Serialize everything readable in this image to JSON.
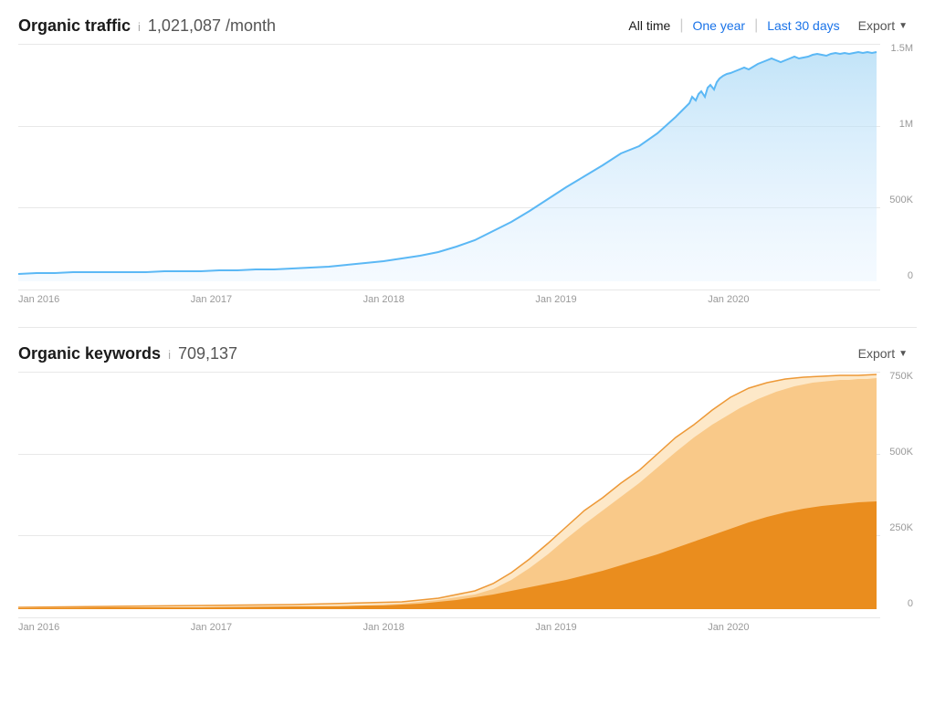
{
  "page": {
    "background": "#ffffff"
  },
  "traffic_chart": {
    "title": "Organic traffic",
    "info_icon": "i",
    "metric": "1,021,087",
    "metric_suffix": "/month",
    "time_filters": [
      {
        "label": "All time",
        "active": true,
        "color": "default"
      },
      {
        "label": "One year",
        "active": false,
        "color": "blue"
      },
      {
        "label": "Last 30 days",
        "active": false,
        "color": "blue"
      }
    ],
    "export_label": "Export",
    "y_labels": [
      "1.5M",
      "1M",
      "500K",
      "0"
    ],
    "x_labels": [
      "Jan 2016",
      "Jan 2017",
      "Jan 2018",
      "Jan 2019",
      "Jan 2020",
      ""
    ],
    "chart_color": "#5bb8f5",
    "chart_fill": "#dceefb"
  },
  "keywords_chart": {
    "title": "Organic keywords",
    "info_icon": "i",
    "metric": "709,137",
    "export_label": "Export",
    "y_labels": [
      "750K",
      "500K",
      "250K",
      "0"
    ],
    "x_labels": [
      "Jan 2016",
      "Jan 2017",
      "Jan 2018",
      "Jan 2019",
      "Jan 2020",
      ""
    ],
    "chart_color_dark": "#e8820c",
    "chart_fill_dark": "#f5a623",
    "chart_fill_light": "#fcd9a8"
  }
}
